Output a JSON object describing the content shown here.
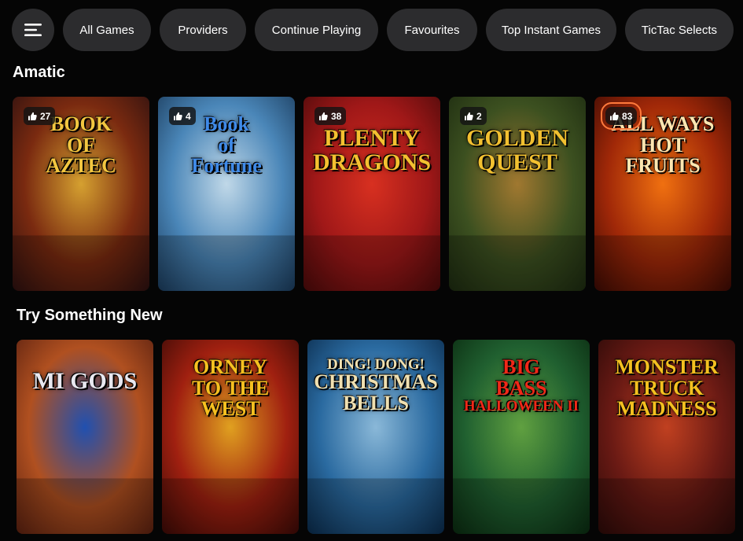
{
  "nav": {
    "menu_icon": "hamburger-menu-icon",
    "items": [
      "All Games",
      "Providers",
      "Continue Playing",
      "Favourites",
      "Top Instant Games",
      "TicTac Selects"
    ]
  },
  "sections": [
    {
      "title": "Amatic",
      "games": [
        {
          "title_lines": [
            "BOOK",
            "OF",
            "AZTEC"
          ],
          "likes": "27",
          "colors": [
            "#2b1010",
            "#7a2a10",
            "#d5a030"
          ],
          "text_color": "#f2c640"
        },
        {
          "title_lines": [
            "Book",
            "of",
            "Fortune"
          ],
          "likes": "4",
          "colors": [
            "#1a3a5a",
            "#4a86b8",
            "#c0d8e8"
          ],
          "text_color": "#3f8ae8"
        },
        {
          "title_lines": [
            "PLENTY",
            "DRAGONS"
          ],
          "likes": "38",
          "colors": [
            "#4a0a0a",
            "#a01818",
            "#d83020"
          ],
          "text_color": "#f4c030"
        },
        {
          "title_lines": [
            "GOLDEN",
            "QUEST"
          ],
          "likes": "2",
          "colors": [
            "#1c2a10",
            "#3c5020",
            "#a07830"
          ],
          "text_color": "#f2c030"
        },
        {
          "title_lines": [
            "ALL WAYS",
            "HOT",
            "FRUITS"
          ],
          "likes": "83",
          "colors": [
            "#3a0a04",
            "#a02808",
            "#f07010"
          ],
          "text_color": "#ffe6b0"
        }
      ]
    },
    {
      "title": "Try Something New",
      "games": [
        {
          "title_lines": [
            "MI GODS"
          ],
          "colors": [
            "#5a2010",
            "#b05020",
            "#2050b0"
          ],
          "text_color": "#e8e8f0"
        },
        {
          "title_lines": [
            "ORNEY",
            "TO THE",
            "WEST"
          ],
          "colors": [
            "#3a0a06",
            "#a02010",
            "#e0a020"
          ],
          "text_color": "#f6c020"
        },
        {
          "title_lines": [
            "DING! DONG!",
            "CHRISTMAS",
            "BELLS"
          ],
          "colors": [
            "#0a2a4a",
            "#2a6aa0",
            "#8ab8d8"
          ],
          "text_color": "#f0e0b0"
        },
        {
          "title_lines": [
            "BIG",
            "BASS",
            "HALLOWEEN II"
          ],
          "colors": [
            "#0a2a10",
            "#206030",
            "#60a040"
          ],
          "text_color": "#f02818"
        },
        {
          "title_lines": [
            "MONSTER",
            "TRUCK",
            "MADNESS"
          ],
          "colors": [
            "#2a0a08",
            "#6a1a14",
            "#c04020"
          ],
          "text_color": "#f4c020"
        }
      ]
    }
  ]
}
